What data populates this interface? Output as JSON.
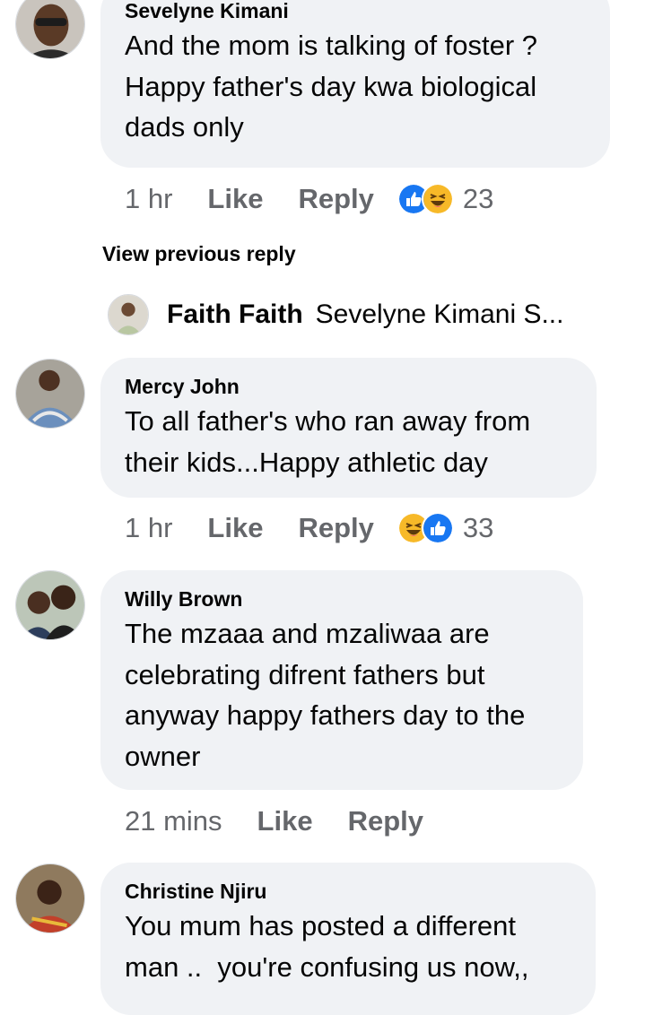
{
  "comments": [
    {
      "author": "Sevelyne Kimani",
      "lines": [
        "And the mom is talking of foster ?",
        "Happy father's day kwa biological",
        "dads only"
      ],
      "time": "1 hr",
      "like_label": "Like",
      "reply_label": "Reply",
      "reaction_icons": [
        "like-icon",
        "haha-icon"
      ],
      "reaction_count": "23"
    },
    {
      "author": "Mercy John",
      "lines": [
        "To all father's who ran away from",
        "their kids...Happy athletic day"
      ],
      "time": "1 hr",
      "like_label": "Like",
      "reply_label": "Reply",
      "reaction_icons": [
        "haha-icon",
        "like-icon"
      ],
      "reaction_count": "33"
    },
    {
      "author": "Willy Brown",
      "lines": [
        "The mzaaa and mzaliwaa are",
        "celebrating difrent fathers but",
        "anyway happy fathers day to the",
        "owner"
      ],
      "time": "21 mins",
      "like_label": "Like",
      "reply_label": "Reply"
    },
    {
      "author": "Christine Njiru",
      "lines": [
        "You mum has posted a different",
        "man ..  you're confusing us now,,"
      ]
    }
  ],
  "view_previous_reply": "View previous reply",
  "reply_preview": {
    "author": "Faith Faith",
    "snippet": "Sevelyne Kimani S..."
  },
  "colors": {
    "bubble": "#f0f2f5",
    "meta_text": "#65676b",
    "like_blue": "#1877f2",
    "haha_yellow": "#f7b928"
  }
}
